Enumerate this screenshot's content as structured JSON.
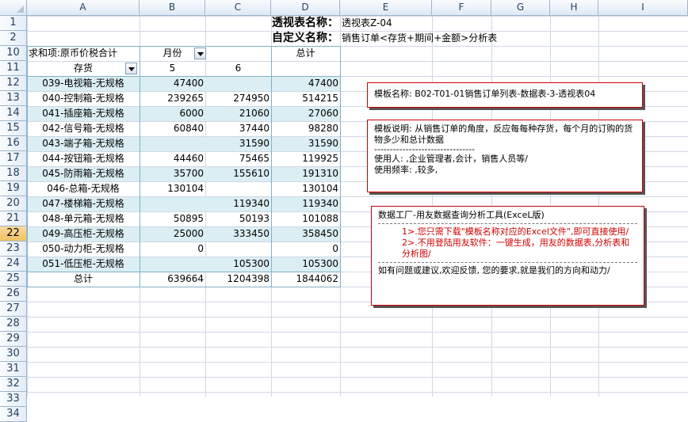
{
  "columns": [
    "A",
    "B",
    "C",
    "D",
    "E",
    "F",
    "G",
    "H",
    "I"
  ],
  "rows": [
    "1",
    "2",
    "10",
    "11",
    "12",
    "13",
    "14",
    "15",
    "16",
    "17",
    "18",
    "19",
    "20",
    "21",
    "22",
    "23",
    "24",
    "25",
    "26",
    "27",
    "28",
    "29",
    "30",
    "31",
    "32",
    "33",
    "34"
  ],
  "active_row": "22",
  "header": {
    "title_label": "透视表名称：",
    "title_value": "透视表Z-04",
    "custom_label": "自定义名称：",
    "custom_value": "销售订单<存货+期间+金额>分析表"
  },
  "pivot": {
    "sum_label": "求和项:原币价税合计",
    "month_label": "月份",
    "item_label": "存货",
    "col_headers": [
      "5",
      "6",
      "总计"
    ],
    "rows": [
      {
        "name": "039-电视箱-无规格",
        "v5": "47400",
        "v6": "",
        "total": "47400"
      },
      {
        "name": "040-控制箱-无规格",
        "v5": "239265",
        "v6": "274950",
        "total": "514215"
      },
      {
        "name": "041-插座箱-无规格",
        "v5": "6000",
        "v6": "21060",
        "total": "27060"
      },
      {
        "name": "042-信号箱-无规格",
        "v5": "60840",
        "v6": "37440",
        "total": "98280"
      },
      {
        "name": "043-端子箱-无规格",
        "v5": "",
        "v6": "31590",
        "total": "31590"
      },
      {
        "name": "044-按钮箱-无规格",
        "v5": "44460",
        "v6": "75465",
        "total": "119925"
      },
      {
        "name": "045-防雨箱-无规格",
        "v5": "35700",
        "v6": "155610",
        "total": "191310"
      },
      {
        "name": "046-总箱-无规格",
        "v5": "130104",
        "v6": "",
        "total": "130104"
      },
      {
        "name": "047-楼梯箱-无规格",
        "v5": "",
        "v6": "119340",
        "total": "119340"
      },
      {
        "name": "048-单元箱-无规格",
        "v5": "50895",
        "v6": "50193",
        "total": "101088"
      },
      {
        "name": "049-高压柜-无规格",
        "v5": "25000",
        "v6": "333450",
        "total": "358450"
      },
      {
        "name": "050-动力柜-无规格",
        "v5": "0",
        "v6": "",
        "total": "0"
      },
      {
        "name": "051-低压柜-无规格",
        "v5": "",
        "v6": "105300",
        "total": "105300"
      }
    ],
    "total_label": "总计",
    "total_row": {
      "v5": "639664",
      "v6": "1204398",
      "total": "1844062"
    }
  },
  "note1": {
    "text": "模板名称:   B02-T01-01销售订单列表-数据表-3-透视表04"
  },
  "note2": {
    "line1": "模板说明: 从销售订单的角度，反应每每种存货，每个月的订购的货物多少和总计数据",
    "dashes": "--------------------------------",
    "line2": "使用人: ,企业管理者,会计，销售人员等/",
    "line3": "使用频率: ,较多,"
  },
  "note3": {
    "title": "数据工厂-用友数据查询分析工具(ExceL版)",
    "item1": "1>.您只需下载\"模板名称对应的Excel文件\",即可直接使用/",
    "item2": "2>.不用登陆用友软件：一键生成，用友的数据表,分析表和分析图/",
    "footer": "如有问题或建议,欢迎反馈, 您的要求,就是我们的方向和动力/"
  }
}
